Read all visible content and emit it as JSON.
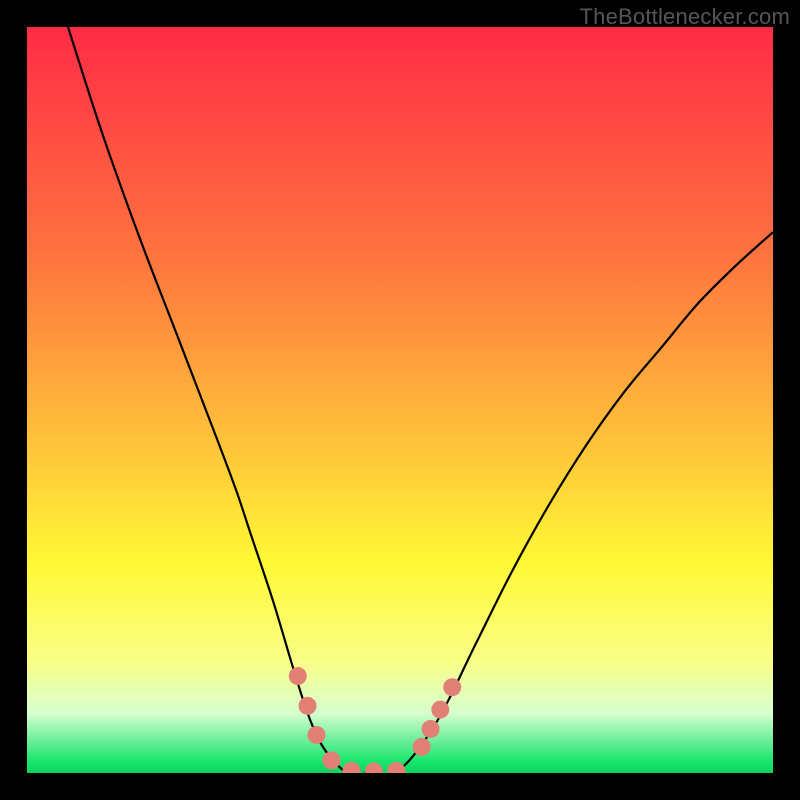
{
  "watermark": "TheBottlenecker.com",
  "colors": {
    "bg_black": "#000000",
    "grad_top": "#ff2b46",
    "grad_mid_orange": "#ffa83a",
    "grad_yellow": "#fff935",
    "grad_pale": "#f7ffb0",
    "grad_green": "#17e66a",
    "curve_stroke": "#000000",
    "marker_fill": "#e38076",
    "watermark": "#565656"
  },
  "chart_data": {
    "type": "line",
    "title": "",
    "xlabel": "",
    "ylabel": "",
    "xlim": [
      0,
      100
    ],
    "ylim": [
      0,
      100
    ],
    "annotations": [],
    "series": [
      {
        "name": "bottleneck-curve",
        "x": [
          5.5,
          10,
          15,
          20,
          25,
          28,
          30,
          33,
          36,
          38,
          40,
          43,
          46,
          50,
          55,
          60,
          65,
          70,
          75,
          80,
          85,
          90,
          95,
          100
        ],
        "y": [
          100,
          86,
          72,
          59,
          46,
          38,
          32,
          23,
          13,
          7,
          3,
          0,
          0,
          0.5,
          7,
          17,
          27,
          36,
          44,
          51,
          57,
          63,
          68,
          72.5
        ]
      }
    ],
    "markers": {
      "name": "highlighted-points",
      "points": [
        {
          "x": 36.3,
          "y": 13.0
        },
        {
          "x": 37.6,
          "y": 9.0
        },
        {
          "x": 38.8,
          "y": 5.1
        },
        {
          "x": 40.8,
          "y": 1.7
        },
        {
          "x": 43.5,
          "y": 0.3
        },
        {
          "x": 46.5,
          "y": 0.2
        },
        {
          "x": 49.5,
          "y": 0.3
        },
        {
          "x": 52.9,
          "y": 3.5
        },
        {
          "x": 54.1,
          "y": 5.9
        },
        {
          "x": 55.4,
          "y": 8.5
        },
        {
          "x": 57.0,
          "y": 11.5
        }
      ]
    },
    "gradient_stops": [
      {
        "offset": 0.0,
        "color": "#ff2b46"
      },
      {
        "offset": 0.3,
        "color": "#ff723f"
      },
      {
        "offset": 0.55,
        "color": "#ffc03a"
      },
      {
        "offset": 0.72,
        "color": "#fff935"
      },
      {
        "offset": 0.85,
        "color": "#f9ff87"
      },
      {
        "offset": 0.92,
        "color": "#d6ffcf"
      },
      {
        "offset": 0.955,
        "color": "#6fef9b"
      },
      {
        "offset": 0.985,
        "color": "#17e66a"
      },
      {
        "offset": 1.0,
        "color": "#0fd15e"
      }
    ]
  }
}
